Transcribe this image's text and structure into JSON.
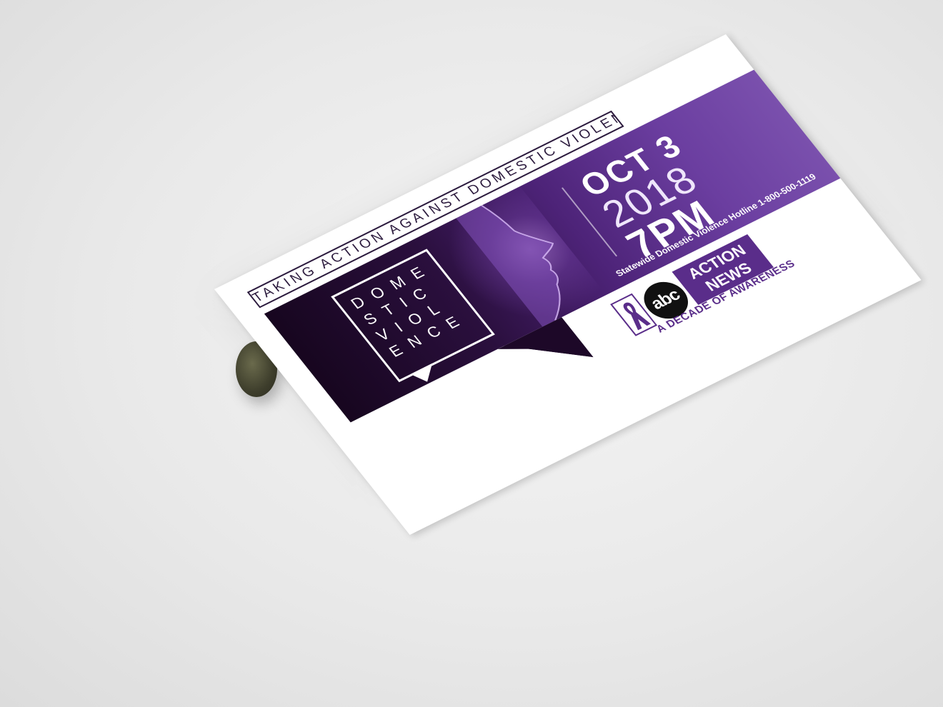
{
  "card": {
    "tagline": "TAKING ACTION AGAINST DOMESTIC VIOLENCE",
    "dv_logo_lines": [
      "DOME",
      "STIC",
      "VIOL",
      "ENCE"
    ],
    "date_line1": "OCT 3",
    "date_line2": "2018",
    "date_line3": "7PM",
    "hotline": "Statewide Domestic Violence Hotline 1-800-500-1119"
  },
  "sponsor": {
    "abc": "abc",
    "action_line1": "ACTION",
    "action_line2": "NEWS",
    "subtitle": "A DECADE OF AWARENESS"
  },
  "colors": {
    "accent_purple": "#5a2d8a",
    "dark_purple": "#17061f",
    "background": "#ececec"
  }
}
